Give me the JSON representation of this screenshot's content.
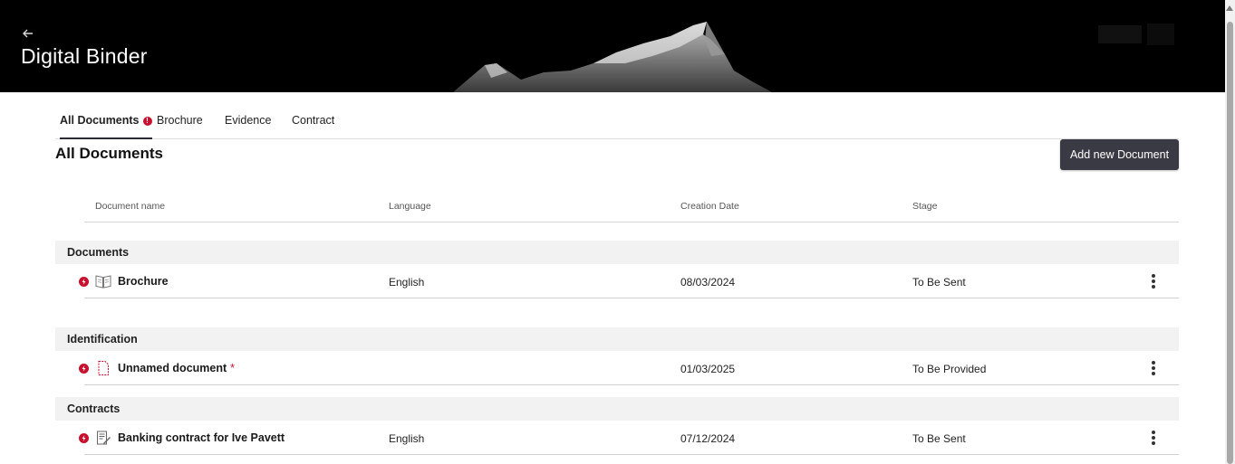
{
  "header": {
    "title": "Digital Binder",
    "back_icon": "arrow-left-icon"
  },
  "tabs": [
    {
      "label": "All Documents",
      "active": true,
      "badge": "!"
    },
    {
      "label": "Brochure",
      "active": false
    },
    {
      "label": "Evidence",
      "active": false
    },
    {
      "label": "Contract",
      "active": false
    }
  ],
  "main": {
    "title": "All Documents",
    "add_button": "Add new Document"
  },
  "table": {
    "columns": [
      "Document name",
      "Language",
      "Creation Date",
      "Stage"
    ],
    "groups": [
      {
        "name": "Documents",
        "rows": [
          {
            "name": "Brochure",
            "icon": "brochure-icon",
            "required": false,
            "language": "English",
            "date": "08/03/2024",
            "stage": "To Be Sent"
          }
        ]
      },
      {
        "name": "Identification",
        "rows": [
          {
            "name": "Unnamed document",
            "icon": "document-icon",
            "required": true,
            "required_mark": "*",
            "language": "",
            "date": "01/03/2025",
            "stage": "To Be Provided"
          }
        ]
      },
      {
        "name": "Contracts",
        "rows": [
          {
            "name": "Banking contract for Ive Pavett",
            "icon": "contract-icon",
            "required": false,
            "language": "English",
            "date": "07/12/2024",
            "stage": "To Be Sent"
          }
        ]
      }
    ]
  },
  "colors": {
    "header_bg": "#000000",
    "button_bg": "#3a3a44",
    "alert": "#c8102e",
    "group_bg": "#f2f2f2"
  }
}
